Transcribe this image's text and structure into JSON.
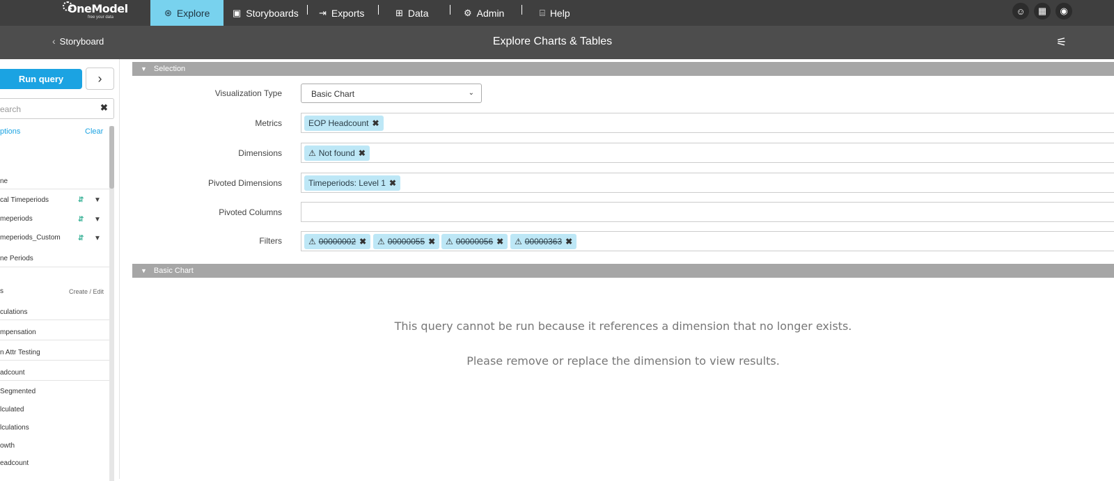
{
  "app": {
    "logo_text": "OneModel",
    "logo_tagline": "free your data"
  },
  "nav": {
    "items": [
      {
        "label": "Explore",
        "icon": "compass-icon"
      },
      {
        "label": "Storyboards",
        "icon": "storyboard-icon"
      },
      {
        "label": "Exports",
        "icon": "export-icon"
      },
      {
        "label": "Data",
        "icon": "data-icon"
      },
      {
        "label": "Admin",
        "icon": "gear-icon"
      },
      {
        "label": "Help",
        "icon": "help-icon"
      }
    ],
    "active": "Explore",
    "right_icons": [
      "users-icon",
      "calendar-icon",
      "user-circle-icon"
    ]
  },
  "subheader": {
    "back_label": "Storyboard",
    "title": "Explore Charts & Tables"
  },
  "sidebar": {
    "run_query_label": "Run query",
    "search_placeholder": "earch",
    "options_label": "ptions",
    "clear_label": "Clear",
    "time_header": "ne",
    "time_items": [
      "cal Timeperiods",
      "meperiods",
      "meperiods_Custom",
      "ne Periods"
    ],
    "metrics_header": "s",
    "create_edit_label": "Create / Edit",
    "metric_items": [
      "culations",
      "mpensation",
      "n Attr Testing",
      "adcount",
      "Segmented",
      "lculated",
      "lculations",
      "owth",
      "eadcount"
    ]
  },
  "selection": {
    "section_title": "Selection",
    "visualization_type_label": "Visualization Type",
    "visualization_type_value": "Basic Chart",
    "metrics_label": "Metrics",
    "metrics": [
      "EOP Headcount"
    ],
    "dimensions_label": "Dimensions",
    "dimensions": [
      "Not found"
    ],
    "pivoted_dimensions_label": "Pivoted Dimensions",
    "pivoted_dimensions": [
      "Timeperiods: Level 1"
    ],
    "pivoted_columns_label": "Pivoted Columns",
    "filters_label": "Filters",
    "filters": [
      "00000002",
      "00000055",
      "00000056",
      "00000363"
    ]
  },
  "chart": {
    "section_title": "Basic Chart",
    "message_1": "This query cannot be run because it references a dimension that no longer exists.",
    "message_2": "Please remove or replace the dimension to view results."
  },
  "colors": {
    "nav_bg": "#3f3f3f",
    "nav_active": "#78d2ee",
    "primary": "#1ba3e2",
    "chip_bg": "#bde7f6",
    "section_bar": "#a6a6a6"
  }
}
